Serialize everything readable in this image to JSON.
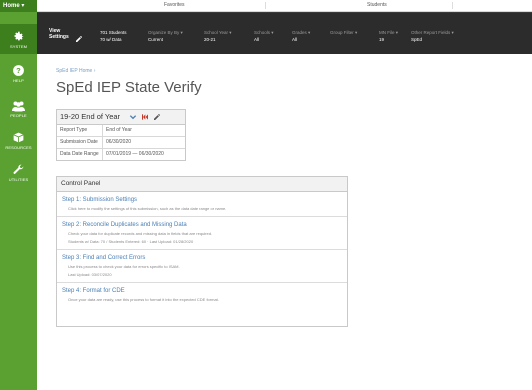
{
  "sidebar": {
    "home_label": "Home ▾",
    "items": [
      {
        "label": "SYSTEM",
        "icon": "gear-icon"
      },
      {
        "label": "HELP",
        "icon": "question-icon"
      },
      {
        "label": "PEOPLE",
        "icon": "people-icon"
      },
      {
        "label": "RESOURCES",
        "icon": "box-icon"
      },
      {
        "label": "UTILITIES",
        "icon": "wrench-icon"
      }
    ]
  },
  "topbar": {
    "favorites": "Favorites",
    "students": "Students"
  },
  "settings_bar": {
    "view_settings": [
      "View",
      "Settings"
    ],
    "students_count": "701 Students",
    "active_status": "70 w/ Data",
    "columns": [
      {
        "label": "Organize By By ▾",
        "value": "Current"
      },
      {
        "label": "School Year ▾",
        "value": "20-21"
      },
      {
        "label": "Schools ▾",
        "value": "All"
      },
      {
        "label": "Grades ▾",
        "value": "All"
      },
      {
        "label": "Group Filter ▾",
        "value": ""
      },
      {
        "label": "MN File ▾",
        "value": "19"
      },
      {
        "label": "Other Report Fields ▾",
        "value": "SpEd"
      }
    ]
  },
  "breadcrumb": "SpEd IEP Home  ›",
  "page_title": "SpEd IEP State Verify",
  "submission": {
    "name": "19-20 End of Year",
    "rows": [
      {
        "key": "Report Type",
        "value": "End of Year"
      },
      {
        "key": "Submission Date",
        "value": "06/30/2020"
      },
      {
        "key": "Data Date Range",
        "value": "07/01/2019 — 06/30/2020"
      }
    ]
  },
  "control_panel": {
    "title": "Control Panel",
    "steps": [
      {
        "title": "Step 1: Submission Settings",
        "details": [
          "Click here to modify the settings of this submission, such as the data date range or name."
        ]
      },
      {
        "title": "Step 2: Reconcile Duplicates and Missing Data",
        "details": [
          "Check your data for duplicate records and missing data in fields that are required.",
          "Students w/ Data: 70 / Students Entered: 60 · Last Upload: 01/28/2020"
        ]
      },
      {
        "title": "Step 3: Find and Correct Errors",
        "details": [
          "Use this process to check your data for errors specific to ISAM.",
          "Last Upload: 03/07/2020"
        ]
      },
      {
        "title": "Step 4: Format for CDE",
        "details": [
          "Once your data are ready, use this process to format it into the expected CDE format."
        ]
      }
    ]
  },
  "colors": {
    "sidebar_green": "#5aa132",
    "sidebar_dark_green": "#3d7f1d",
    "settings_bar": "#2c2c2c",
    "link_blue": "#4a7fb5"
  }
}
